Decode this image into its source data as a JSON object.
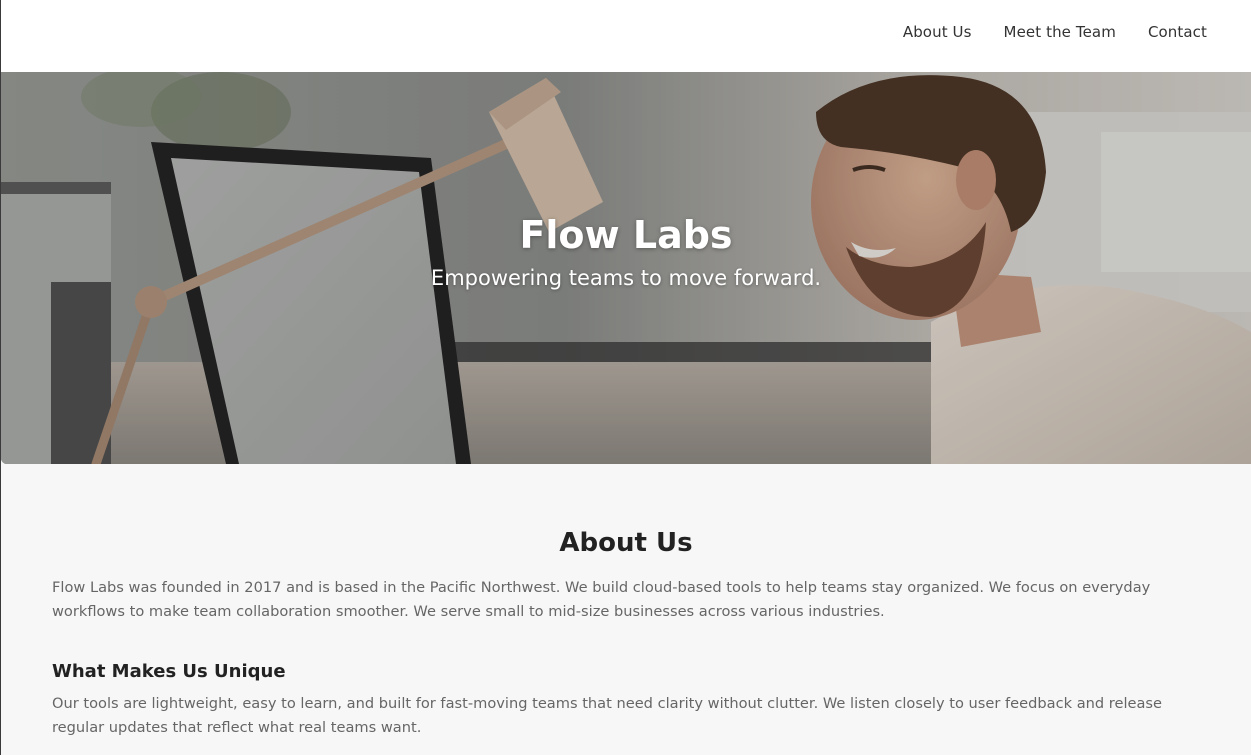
{
  "nav": {
    "links": [
      {
        "label": "About Us"
      },
      {
        "label": "Meet the Team"
      },
      {
        "label": "Contact"
      }
    ]
  },
  "hero": {
    "title": "Flow Labs",
    "subtitle": "Empowering teams to move forward.",
    "image": "office-man-smiling-at-computer-photo"
  },
  "about": {
    "heading": "About Us",
    "body": "Flow Labs was founded in 2017 and is based in the Pacific Northwest. We build cloud-based tools to help teams stay organized. We focus on everyday workflows to make team collaboration smoother. We serve small to mid-size businesses across various industries.",
    "unique_heading": "What Makes Us Unique",
    "unique_body": "Our tools are lightweight, easy to learn, and built for fast-moving teams that need clarity without clutter. We listen closely to user feedback and release regular updates that reflect what real teams want."
  },
  "colors": {
    "nav_bg": "#ffffff",
    "page_bg": "#f7f7f7",
    "heading": "#222222",
    "body_text": "#666666",
    "hero_text": "#ffffff"
  }
}
